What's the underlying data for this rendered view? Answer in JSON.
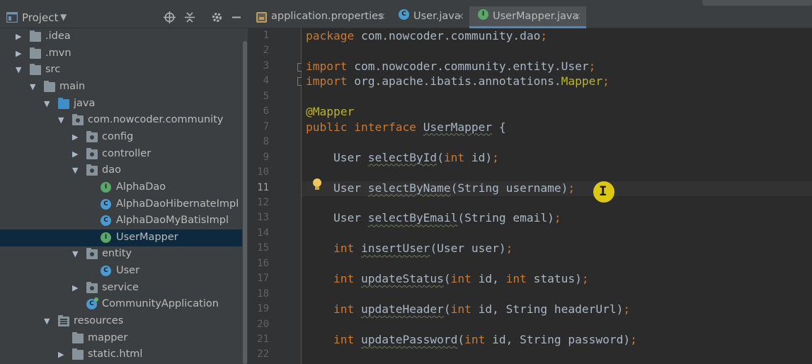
{
  "colors": {
    "panel_bg": "#3c3f41",
    "editor_bg": "#2b2b2b",
    "gutter_bg": "#313335",
    "selection": "#0d293e",
    "keyword": "#cc7832",
    "annotation": "#bbb529",
    "text": "#a9b7c6",
    "accent_tab_underline": "#4a88c7",
    "cursor_highlight": "#e7d014"
  },
  "project_panel": {
    "title": "Project",
    "dropdown_glyph": "▼",
    "toolbar_icons": [
      "crosshair-icon",
      "collapse-all-icon",
      "gear-icon",
      "minimize-icon"
    ],
    "tree": [
      {
        "label": ".idea",
        "depth": 0,
        "arrow": "▶",
        "icon": "folder-icon",
        "selected": false
      },
      {
        "label": ".mvn",
        "depth": 0,
        "arrow": "▶",
        "icon": "folder-icon",
        "selected": false
      },
      {
        "label": "src",
        "depth": 0,
        "arrow": "▼",
        "icon": "folder-icon",
        "selected": false
      },
      {
        "label": "main",
        "depth": 1,
        "arrow": "▼",
        "icon": "folder-icon",
        "selected": false
      },
      {
        "label": "java",
        "depth": 2,
        "arrow": "▼",
        "icon": "source-folder-icon",
        "selected": false
      },
      {
        "label": "com.nowcoder.community",
        "depth": 3,
        "arrow": "▼",
        "icon": "package-icon",
        "selected": false
      },
      {
        "label": "config",
        "depth": 4,
        "arrow": "▶",
        "icon": "package-icon",
        "selected": false
      },
      {
        "label": "controller",
        "depth": 4,
        "arrow": "▶",
        "icon": "package-icon",
        "selected": false
      },
      {
        "label": "dao",
        "depth": 4,
        "arrow": "▼",
        "icon": "package-icon",
        "selected": false
      },
      {
        "label": "AlphaDao",
        "depth": 5,
        "arrow": "",
        "icon": "interface-icon",
        "selected": false
      },
      {
        "label": "AlphaDaoHibernateImpl",
        "depth": 5,
        "arrow": "",
        "icon": "class-icon",
        "selected": false
      },
      {
        "label": "AlphaDaoMyBatisImpl",
        "depth": 5,
        "arrow": "",
        "icon": "class-icon",
        "selected": false
      },
      {
        "label": "UserMapper",
        "depth": 5,
        "arrow": "",
        "icon": "interface-icon",
        "selected": true
      },
      {
        "label": "entity",
        "depth": 4,
        "arrow": "▼",
        "icon": "package-icon",
        "selected": false
      },
      {
        "label": "User",
        "depth": 5,
        "arrow": "",
        "icon": "class-icon",
        "selected": false
      },
      {
        "label": "service",
        "depth": 4,
        "arrow": "▶",
        "icon": "package-icon",
        "selected": false
      },
      {
        "label": "CommunityApplication",
        "depth": 4,
        "arrow": "",
        "icon": "spring-app-icon",
        "selected": false
      },
      {
        "label": "resources",
        "depth": 2,
        "arrow": "▼",
        "icon": "resources-folder-icon",
        "selected": false
      },
      {
        "label": "mapper",
        "depth": 3,
        "arrow": "",
        "icon": "folder-icon",
        "selected": false
      },
      {
        "label": "static.html",
        "depth": 3,
        "arrow": "▶",
        "icon": "folder-icon",
        "selected": false
      }
    ]
  },
  "tabs": [
    {
      "label": "application.properties",
      "icon": "properties-file-icon",
      "active": false,
      "close": "×"
    },
    {
      "label": "User.java",
      "icon": "class-icon",
      "active": false,
      "close": "×"
    },
    {
      "label": "UserMapper.java",
      "icon": "interface-icon",
      "active": true,
      "close": "×"
    }
  ],
  "editor": {
    "current_line": 11,
    "lines": [
      {
        "n": "1",
        "tokens": [
          [
            "kw",
            "package"
          ],
          [
            "pl",
            " com.nowcoder.community.dao"
          ],
          [
            "kw",
            ";"
          ]
        ]
      },
      {
        "n": "2",
        "tokens": []
      },
      {
        "n": "3",
        "tokens": [
          [
            "kw",
            "import"
          ],
          [
            "pl",
            " com.nowcoder.community.entity.User"
          ],
          [
            "kw",
            ";"
          ]
        ]
      },
      {
        "n": "4",
        "tokens": [
          [
            "kw",
            "import"
          ],
          [
            "pl",
            " org.apache.ibatis.annotations."
          ],
          [
            "ann",
            "Mapper"
          ],
          [
            "kw",
            ";"
          ]
        ]
      },
      {
        "n": "5",
        "tokens": []
      },
      {
        "n": "6",
        "tokens": [
          [
            "ann",
            "@Mapper"
          ]
        ]
      },
      {
        "n": "7",
        "tokens": [
          [
            "kw",
            "public interface "
          ],
          [
            "nm",
            "UserMapper"
          ],
          [
            "pl",
            " {"
          ]
        ]
      },
      {
        "n": "8",
        "tokens": []
      },
      {
        "n": "9",
        "tokens": [
          [
            "pl",
            "    User "
          ],
          [
            "nm",
            "selectById"
          ],
          [
            "pl",
            "("
          ],
          [
            "kw",
            "int"
          ],
          [
            "pl",
            " id)"
          ],
          [
            "kw",
            ";"
          ]
        ]
      },
      {
        "n": "10",
        "tokens": []
      },
      {
        "n": "11",
        "tokens": [
          [
            "pl",
            "    User "
          ],
          [
            "nm",
            "selectByName"
          ],
          [
            "pl",
            "(String username)"
          ],
          [
            "kw",
            ";"
          ]
        ]
      },
      {
        "n": "12",
        "tokens": []
      },
      {
        "n": "13",
        "tokens": [
          [
            "pl",
            "    User "
          ],
          [
            "nm",
            "selectByEmail"
          ],
          [
            "pl",
            "(String email)"
          ],
          [
            "kw",
            ";"
          ]
        ]
      },
      {
        "n": "14",
        "tokens": []
      },
      {
        "n": "15",
        "tokens": [
          [
            "kw",
            "    int "
          ],
          [
            "nm",
            "insertUser"
          ],
          [
            "pl",
            "(User user)"
          ],
          [
            "kw",
            ";"
          ]
        ]
      },
      {
        "n": "16",
        "tokens": []
      },
      {
        "n": "17",
        "tokens": [
          [
            "kw",
            "    int "
          ],
          [
            "nm",
            "updateStatus"
          ],
          [
            "pl",
            "("
          ],
          [
            "kw",
            "int"
          ],
          [
            "pl",
            " id, "
          ],
          [
            "kw",
            "int"
          ],
          [
            "pl",
            " status)"
          ],
          [
            "kw",
            ";"
          ]
        ]
      },
      {
        "n": "18",
        "tokens": []
      },
      {
        "n": "19",
        "tokens": [
          [
            "kw",
            "    int "
          ],
          [
            "nm",
            "updateHeader"
          ],
          [
            "pl",
            "("
          ],
          [
            "kw",
            "int"
          ],
          [
            "pl",
            " id, String headerUrl)"
          ],
          [
            "kw",
            ";"
          ]
        ]
      },
      {
        "n": "20",
        "tokens": []
      },
      {
        "n": "21",
        "tokens": [
          [
            "kw",
            "    int "
          ],
          [
            "nm",
            "updatePassword"
          ],
          [
            "pl",
            "("
          ],
          [
            "kw",
            "int"
          ],
          [
            "pl",
            " id, String password)"
          ],
          [
            "kw",
            ";"
          ]
        ]
      },
      {
        "n": "22",
        "tokens": []
      }
    ]
  },
  "text_cursor_glyph": "I"
}
